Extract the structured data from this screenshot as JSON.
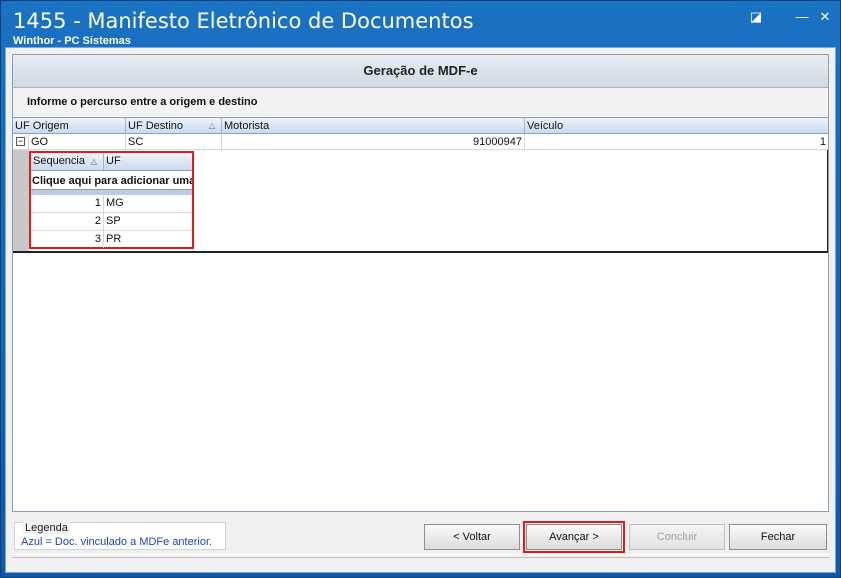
{
  "window": {
    "title": "1455 - Manifesto Eletrônico de Documentos",
    "subtitle": "Winthor - PC Sistemas",
    "controls": {
      "restore": "◪",
      "minimize": "—",
      "close": "✕"
    }
  },
  "panel": {
    "header": "Geração de MDF-e",
    "instruction": "Informe o percurso entre a origem e destino"
  },
  "grid": {
    "columns": [
      "UF Origem",
      "UF Destino",
      "Motorista",
      "Veículo"
    ],
    "sort_indicator": "△",
    "row": {
      "expander": "−",
      "uf_origem": "GO",
      "uf_destino": "SC",
      "motorista": "91000947",
      "veiculo": "1"
    }
  },
  "subgrid": {
    "columns": [
      "Sequencia",
      "UF"
    ],
    "sort_indicator": "△",
    "add_row": "Clique aqui para adicionar uma nova linha",
    "rows": [
      {
        "seq": "1",
        "uf": "MG"
      },
      {
        "seq": "2",
        "uf": "SP"
      },
      {
        "seq": "3",
        "uf": "PR"
      }
    ]
  },
  "legend": {
    "title": "Legenda",
    "text": "Azul = Doc. vinculado a MDFe anterior."
  },
  "buttons": {
    "voltar": "< Voltar",
    "avancar": "Avançar >",
    "concluir": "Concluir",
    "fechar": "Fechar"
  }
}
